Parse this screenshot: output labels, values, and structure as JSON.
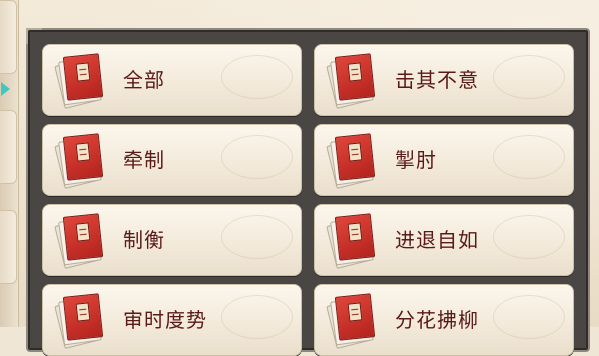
{
  "tactics": [
    {
      "label": "全部"
    },
    {
      "label": "击其不意"
    },
    {
      "label": "牵制"
    },
    {
      "label": "掣肘"
    },
    {
      "label": "制衡"
    },
    {
      "label": "进退自如"
    },
    {
      "label": "审时度势"
    },
    {
      "label": "分花拂柳"
    }
  ],
  "colors": {
    "label_text": "#5a1a16",
    "book_cover": "#c7302a",
    "panel": "#4a4643",
    "card": "#f6efe2",
    "accent_arrow": "#3fc7c0"
  },
  "icons": {
    "item_icon": "tactic-book-icon",
    "side_arrow": "arrow-right-icon"
  }
}
